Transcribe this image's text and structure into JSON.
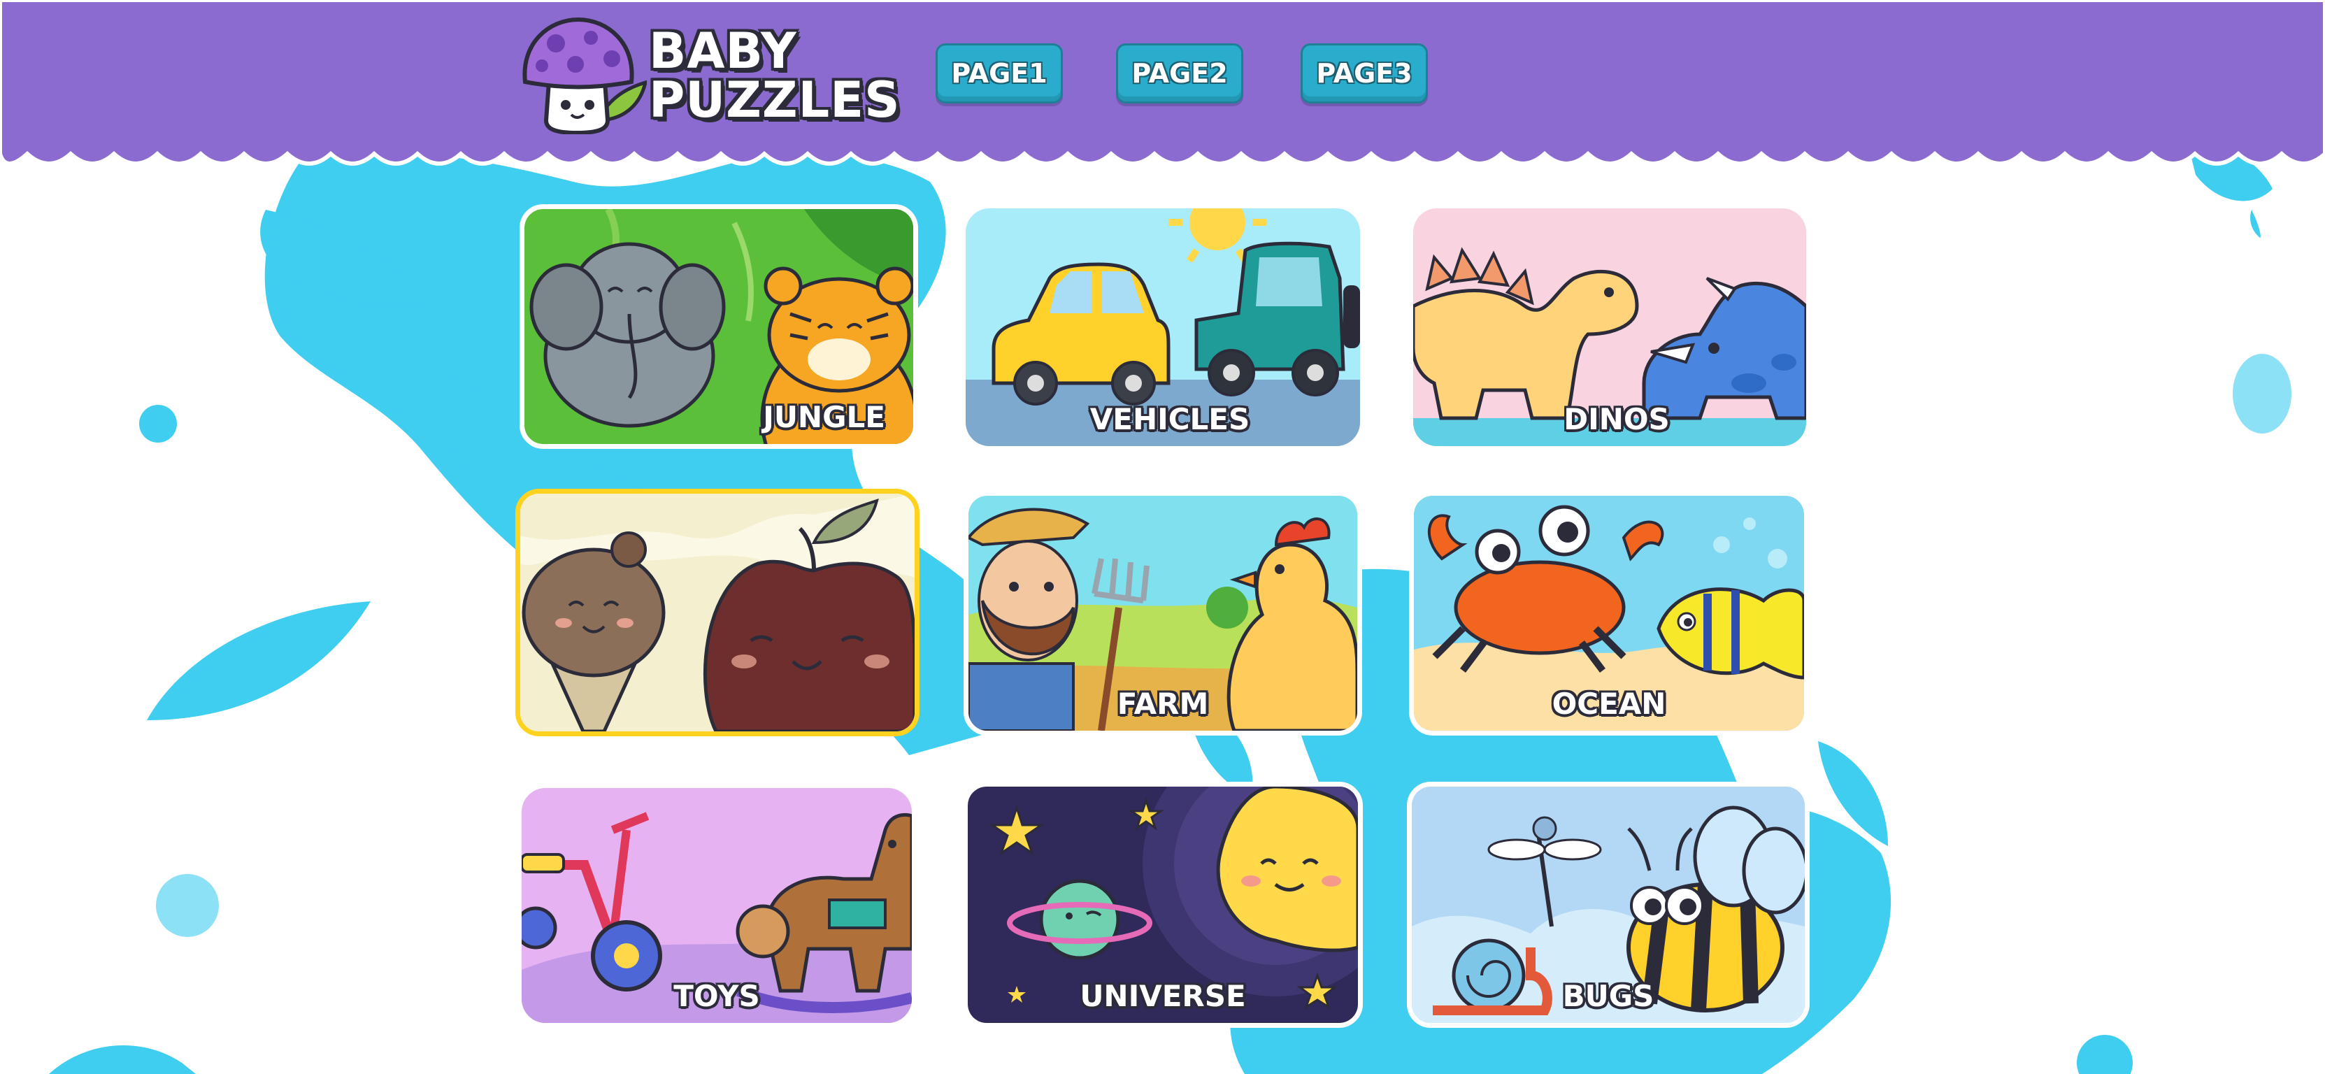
{
  "brand": {
    "line1": "BABY",
    "line2": "PUZZLES",
    "logo_icon": "mushroom-icon"
  },
  "nav": [
    {
      "label": "PAGE1"
    },
    {
      "label": "PAGE2"
    },
    {
      "label": "PAGE3"
    }
  ],
  "colors": {
    "header": "#8b6bd0",
    "background_splash": "#3fcdf0",
    "nav_button": "#2aaccc",
    "selected_border": "#ffd21f"
  },
  "categories": [
    {
      "label": "JUNGLE",
      "illustration": "elephant-and-tiger"
    },
    {
      "label": "VEHICLES",
      "illustration": "car-and-jeep"
    },
    {
      "label": "DINOS",
      "illustration": "stegosaurus-and-triceratops"
    },
    {
      "label": "",
      "illustration": "ice-cream-and-apple",
      "selected": true
    },
    {
      "label": "FARM",
      "illustration": "farmer-and-chicken"
    },
    {
      "label": "OCEAN",
      "illustration": "crab-and-fish"
    },
    {
      "label": "TOYS",
      "illustration": "tricycle-and-rocking-horse"
    },
    {
      "label": "UNIVERSE",
      "illustration": "sun-and-planet"
    },
    {
      "label": "BUGS",
      "illustration": "bee-snail-dragonfly"
    }
  ]
}
